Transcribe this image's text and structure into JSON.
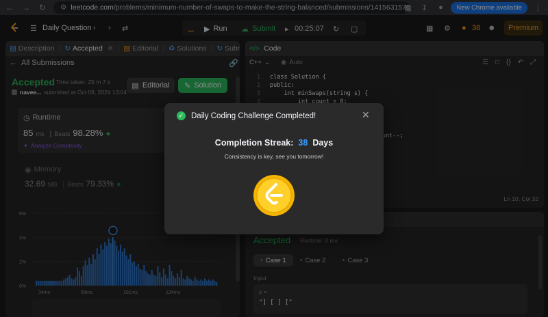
{
  "browser": {
    "url_host": "leetcode.com",
    "url_path": "/problems/minimum-number-of-swaps-to-make-the-string-balanced/submissions/1415631570/?...",
    "update_label": "New Chrome available"
  },
  "topbar": {
    "daily_label": "Daily Question",
    "run_label": "Run",
    "submit_label": "Submit",
    "timer": "00:25:07",
    "streak_count": "38",
    "premium_label": "Premium"
  },
  "left_tabs": [
    {
      "label": "Description"
    },
    {
      "label": "Accepted"
    },
    {
      "label": "Editorial"
    },
    {
      "label": "Solutions"
    },
    {
      "label": "Submissio"
    }
  ],
  "submission": {
    "back_label": "All Submissions",
    "status": "Accepted",
    "time_taken_label": "Time taken: 25 m 7 s",
    "user": "navee...",
    "submitted_at": "submitted at Oct 08, 2024 13:04",
    "editorial_button": "Editorial",
    "solution_button": "Solution",
    "runtime_title": "Runtime",
    "runtime_value": "85",
    "runtime_unit": "ms",
    "runtime_beats_label": "Beats",
    "runtime_beats": "98.28%",
    "analyze_label": "Analyze Complexity",
    "memory_title": "Memory",
    "memory_value": "32.69",
    "memory_unit": "MB",
    "memory_beats_label": "Beats",
    "memory_beats": "79.33%"
  },
  "chart_data": {
    "type": "bar",
    "y_ticks": [
      "6%",
      "4%",
      "2%",
      "0%"
    ],
    "x_ticks": [
      "34ms",
      "68ms",
      "101ms",
      "134ms"
    ],
    "ylim": [
      0,
      6
    ],
    "values": [
      0.4,
      0.4,
      0.4,
      0.4,
      0.4,
      0.4,
      0.4,
      0.4,
      0.4,
      0.4,
      0.4,
      0.4,
      0.4,
      0.4,
      0.5,
      0.6,
      0.7,
      0.9,
      0.6,
      0.5,
      0.7,
      1.5,
      1.2,
      0.8,
      1.6,
      2.1,
      1.7,
      2.3,
      1.8,
      2.6,
      2.2,
      3.1,
      2.6,
      3.4,
      3.0,
      3.6,
      3.3,
      3.9,
      3.5,
      4.0,
      3.7,
      3.3,
      2.9,
      3.4,
      2.8,
      3.1,
      2.5,
      2.2,
      2.6,
      1.9,
      2.0,
      1.6,
      1.8,
      1.4,
      1.3,
      1.7,
      1.2,
      1.0,
      0.9,
      1.3,
      0.9,
      0.8,
      1.6,
      1.1,
      0.7,
      1.4,
      0.9,
      0.6,
      1.7,
      1.2,
      0.8,
      0.6,
      1.0,
      0.7,
      1.3,
      0.6,
      0.5,
      0.8,
      0.6,
      0.5,
      0.4,
      0.7,
      0.5,
      0.4,
      0.5,
      0.4,
      0.6,
      0.4,
      0.5,
      0.4,
      0.5,
      0.4,
      0.3
    ],
    "highlight_index": 39
  },
  "code_panel": {
    "title": "Code",
    "language": "C++",
    "auto_label": "Auto",
    "lines": [
      {
        "n": "1",
        "text": "class Solution {"
      },
      {
        "n": "2",
        "text": "public:"
      },
      {
        "n": "3",
        "text": "    int minSwaps(string s) {"
      },
      {
        "n": "4",
        "text": "        int count = 0;"
      }
    ],
    "fragment": "unt--;",
    "cursor_pos": "Ln 10, Col 32"
  },
  "result_panel": {
    "status": "Accepted",
    "runtime": "Runtime: 0 ms",
    "cases": [
      "Case 1",
      "Case 2",
      "Case 3"
    ],
    "input_label": "Input",
    "var_name": "s =",
    "var_value": "\"] [ ] [\""
  },
  "modal": {
    "title": "Daily Coding Challenge Completed!",
    "streak_label": "Completion Streak:",
    "streak_value": "38",
    "streak_unit": "Days",
    "message": "Consistency is key, see you tomorrow!"
  },
  "colors": {
    "accent_green": "#2cbb5d",
    "accent_orange": "#ffa116",
    "streak_blue": "#3b9cff",
    "bar_blue": "#2f76c9"
  }
}
